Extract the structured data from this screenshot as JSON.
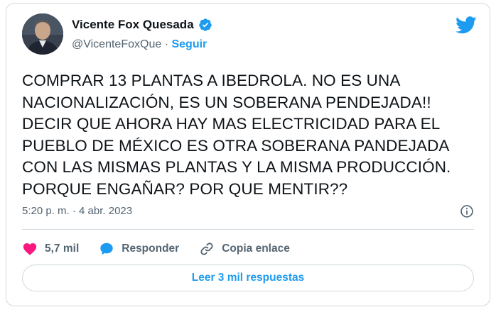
{
  "author": {
    "name": "Vicente Fox Quesada",
    "handle": "@VicenteFoxQue",
    "separator": "·",
    "follow_label": "Seguir",
    "verified_icon": "verified-badge-icon"
  },
  "tweet": {
    "text": "COMPRAR 13 PLANTAS A IBEDROLA. NO ES UNA\nNACIONALIZACIÓN, ES UN SOBERANA PENDEJADA!!\nDECIR QUE AHORA HAY MAS ELECTRICIDAD PARA EL\nPUEBLO DE MÉXICO ES OTRA SOBERANA PANDEJADA\nCON LAS MISMAS PLANTAS Y LA MISMA PRODUCCIÓN.\nPORQUE ENGAÑAR? POR QUE MENTIR??",
    "timestamp": "5:20 p. m. · 4 abr. 2023"
  },
  "actions": {
    "likes_count": "5,7 mil",
    "reply_label": "Responder",
    "copy_link_label": "Copia enlace"
  },
  "read_replies_label": "Leer 3 mil respuestas",
  "colors": {
    "accent": "#1d9bf0",
    "like": "#f91880",
    "muted": "#536471",
    "border": "#cfd9de",
    "text": "#0f1419"
  }
}
